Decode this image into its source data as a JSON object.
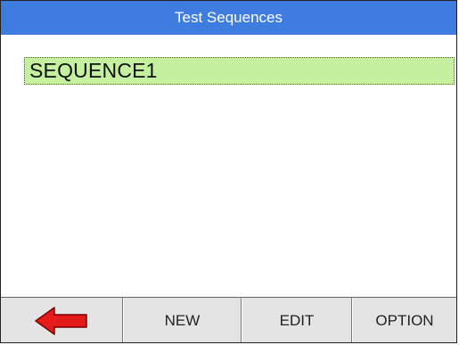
{
  "title_bar": {
    "title": "Test Sequences",
    "color": "#3e7ce0"
  },
  "sequence_list": {
    "items": [
      {
        "label": "SEQUENCE1",
        "selected": true
      }
    ],
    "selected_color": "#c4f0a0"
  },
  "soft_keys": {
    "back": {
      "icon": "left-arrow-icon",
      "color": "#e31b1b"
    },
    "new_label": "NEW",
    "edit_label": "EDIT",
    "option_label": "OPTION"
  }
}
